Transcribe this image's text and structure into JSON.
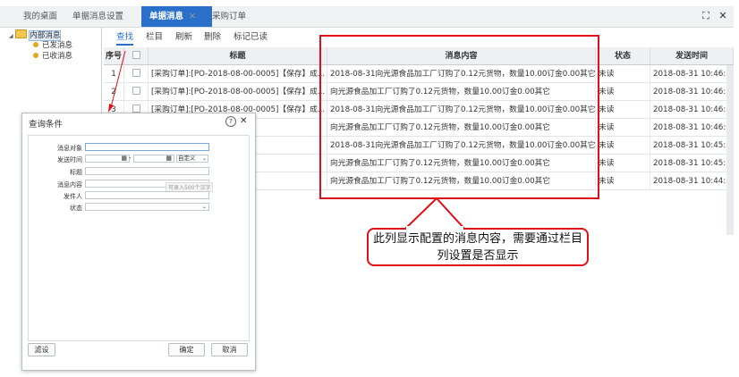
{
  "tabs": [
    {
      "label": "我的桌面"
    },
    {
      "label": "单据消息设置"
    },
    {
      "label": "单据消息",
      "close": "✕"
    },
    {
      "label": "采购订单"
    }
  ],
  "window_buttons": {
    "restore": "⛶",
    "close": "✕"
  },
  "tree": {
    "root": "内部消息",
    "toggle": "◢",
    "children": [
      "已发消息",
      "已收消息"
    ]
  },
  "toolbar": [
    "查找",
    "栏目",
    "刷新",
    "删除",
    "标记已读"
  ],
  "table": {
    "columns": [
      "序号",
      "",
      "标题",
      "消息内容",
      "状态",
      "发送时间"
    ],
    "rows": [
      {
        "seq": "1",
        "title": "[采购订单]:[PO-2018-08-00-0005]【保存】成...",
        "content": "2018-08-31向光源食品加工厂订购了0.12元货物，数量10.00订金0.00其它",
        "status": "未读",
        "time": "2018-08-31 10:46:15"
      },
      {
        "seq": "2",
        "title": "[采购订单]:[PO-2018-08-00-0005]【保存】成...",
        "content": "向光源食品加工厂订购了0.12元货物，数量10.00订金0.00其它",
        "status": "未读",
        "time": "2018-08-31 10:46:12"
      },
      {
        "seq": "3",
        "title": "[采购订单]:[PO-2018-08-00-0005]【保存】成...",
        "content": "2018-08-31向光源食品加工厂订购了0.12元货物，数量10.00订金0.00其它",
        "status": "未读",
        "time": "2018-08-31 10:46:11"
      },
      {
        "seq": "4",
        "title": "0005]【保存】成...",
        "content": "向光源食品加工厂订购了0.12元货物，数量10.00订金0.00其它",
        "status": "未读",
        "time": "2018-08-31 10:46:06"
      },
      {
        "seq": "5",
        "title": "004]【保存】成...",
        "content": "2018-08-31向光源食品加工厂订购了0.12元货物，数量10.00订金0.00其它",
        "status": "未读",
        "time": "2018-08-31 10:45:57"
      },
      {
        "seq": "6",
        "title": "004]【保存】成...",
        "content": "向光源食品加工厂订购了0.12元货物，数量10.00订金0.00其它",
        "status": "未读",
        "time": "2018-08-31 10:45:54"
      },
      {
        "seq": "7",
        "title": "003]【保存】成...",
        "content": "向光源食品加工厂订购了0.12元货物，数量10.00订金0.00其它",
        "status": "未读",
        "time": "2018-08-31 10:44:54"
      }
    ]
  },
  "dialog": {
    "title": "查询条件",
    "help": "?",
    "close": "✕",
    "fields": {
      "target": "消息对象",
      "send_time": "发送时间",
      "date_sep": "-",
      "date_mode": "自定义",
      "title": "标题",
      "content": "消息内容",
      "content_hint": "可录入500个汉字",
      "sender": "发件人",
      "status": "状态"
    },
    "buttons": {
      "filter": "滤设",
      "ok": "确定",
      "cancel": "取消"
    }
  },
  "annotation": "此列显示配置的消息内容，需要通过栏目列设置是否显示",
  "colors": {
    "accent": "#2a6fc9",
    "annotation": "#e0101b",
    "folder": "#f3c74d",
    "dot": "#e8a31c"
  }
}
